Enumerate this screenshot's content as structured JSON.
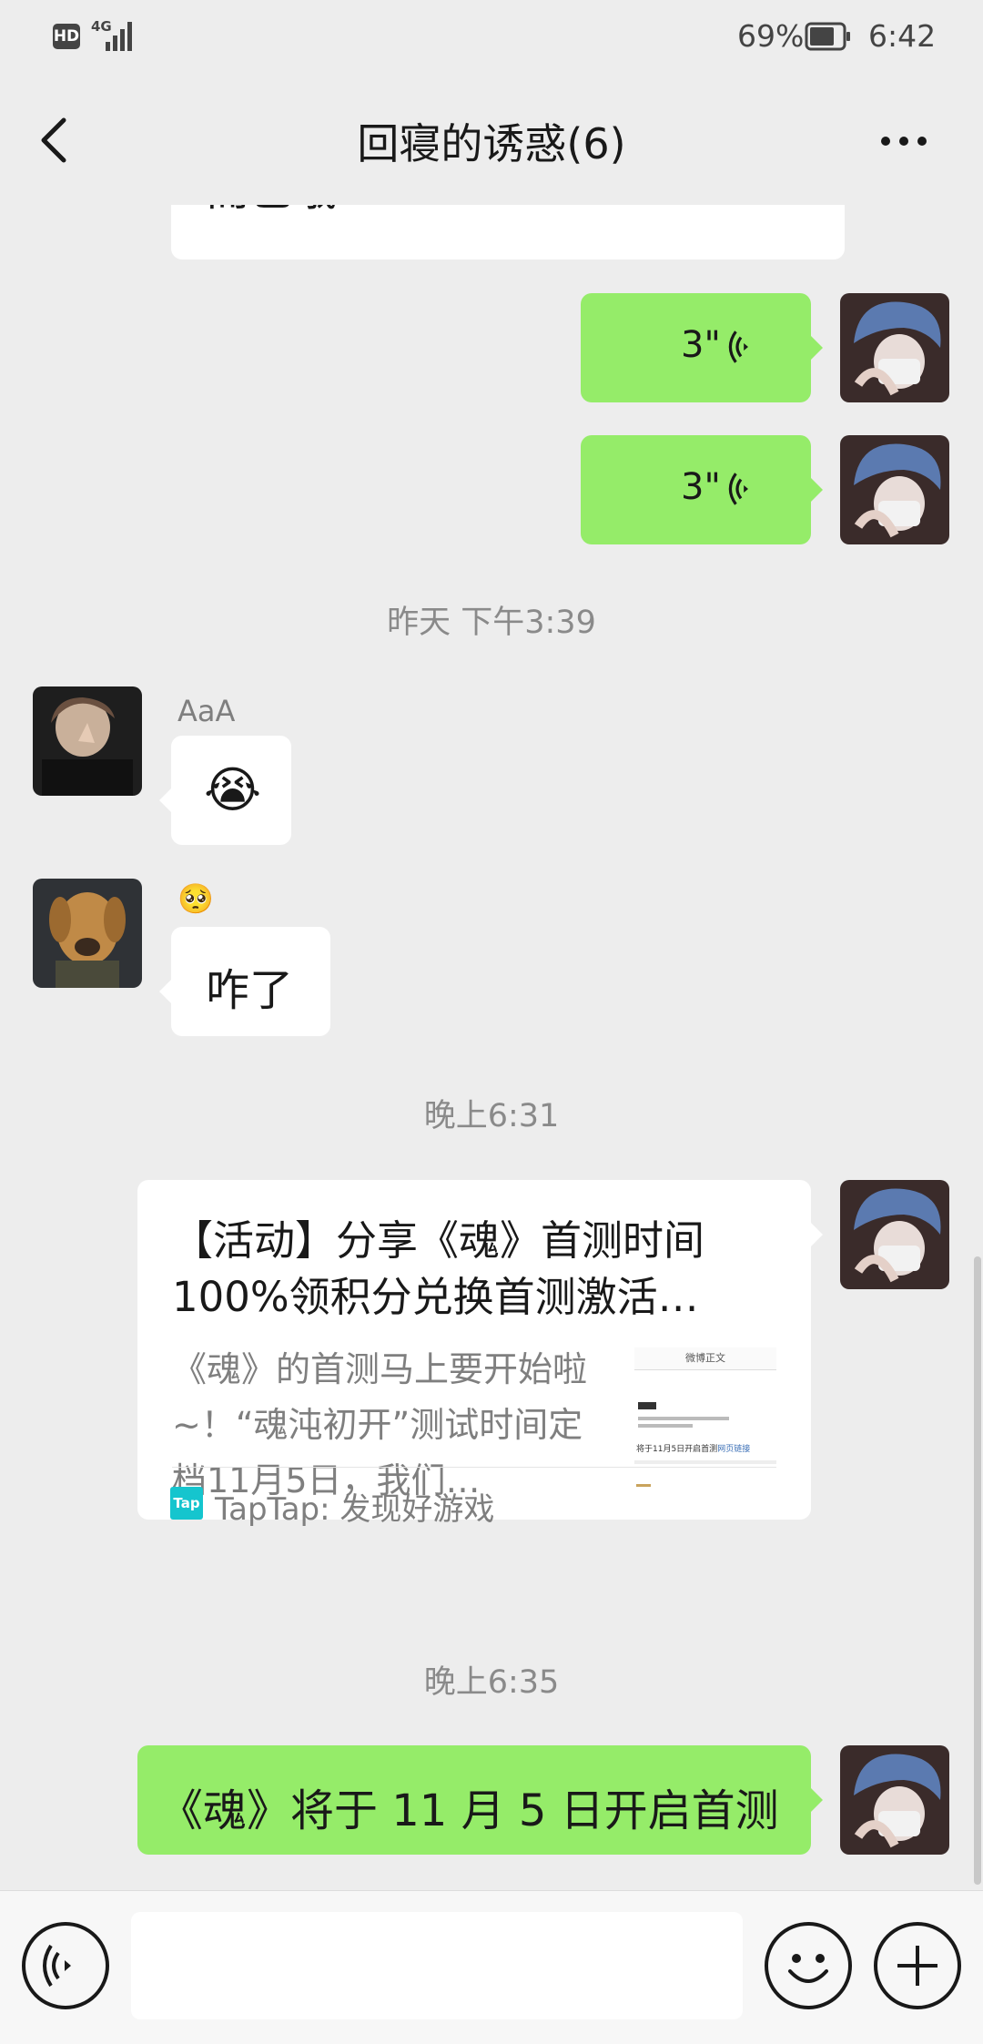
{
  "status_bar": {
    "hd": "HD",
    "network": "4G",
    "battery_percent": "69%",
    "time": "6:42",
    "icons": [
      "signal-icon",
      "battery-icon"
    ]
  },
  "header": {
    "title": "回寝的诱惑(6)",
    "back_icon": "back-chevron-icon",
    "more_icon": "more-dots-icon"
  },
  "messages": {
    "partial_text": "而已哦",
    "voice1": {
      "duration": "3\""
    },
    "voice2": {
      "duration": "3\""
    },
    "ts1": "昨天 下午3:39",
    "msg_aaa": {
      "sender": "AaA",
      "emoji": "😭"
    },
    "msg_dog": {
      "sender": "🥺",
      "text": "咋了"
    },
    "ts2": "晚上6:31",
    "link_card": {
      "title": "【活动】分享《魂》首测时间100%领积分兑换首测激活…",
      "desc": "《魂》的首测马上要开始啦~！“魂沌初开”测试时间定档11月5日，我们…",
      "thumb_header": "微博正文",
      "thumb_line1": "将于11月5日开启首测",
      "thumb_link": "网页链接",
      "source_icon": "Tap",
      "source": "TapTap: 发现好游戏"
    },
    "ts3": "晚上6:35",
    "last_msg": "《魂》将于 11 月 5 日开启首测"
  },
  "input_bar": {
    "voice_icon": "voice-input-icon",
    "emoji_icon": "emoji-icon",
    "plus_icon": "plus-icon"
  },
  "colors": {
    "background": "#ededed",
    "my_bubble": "#95ec69",
    "other_bubble": "#ffffff",
    "timestamp": "#8a8a8a"
  }
}
